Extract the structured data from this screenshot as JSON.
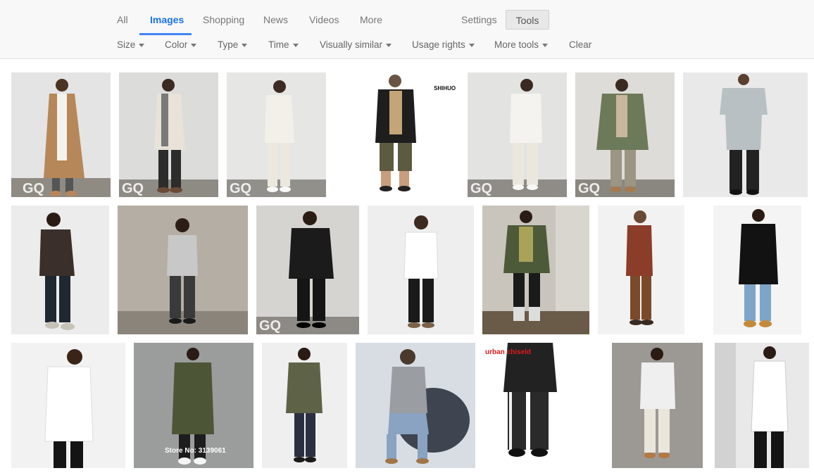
{
  "tabs": [
    {
      "label": "All"
    },
    {
      "label": "Images"
    },
    {
      "label": "Shopping"
    },
    {
      "label": "News"
    },
    {
      "label": "Videos"
    },
    {
      "label": "More"
    }
  ],
  "settings_label": "Settings",
  "tools_label": "Tools",
  "filters": [
    {
      "label": "Size"
    },
    {
      "label": "Color"
    },
    {
      "label": "Type"
    },
    {
      "label": "Time"
    },
    {
      "label": "Visually similar"
    },
    {
      "label": "Usage rights"
    },
    {
      "label": "More tools"
    }
  ],
  "clear_label": "Clear",
  "watermarks": {
    "gq": "GQ",
    "shihuo": "SHIHUO",
    "store": "Store No: 3139061",
    "urban": "urban chiseld"
  }
}
